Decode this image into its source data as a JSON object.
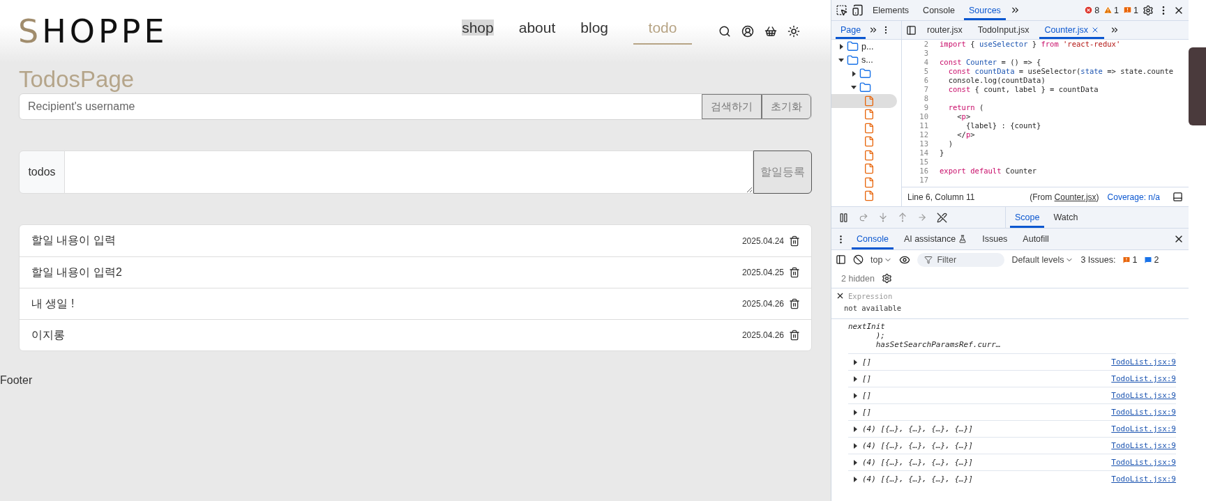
{
  "app": {
    "logo": {
      "first": "S",
      "rest": "HOPPE"
    },
    "nav": [
      {
        "label": "shop",
        "selected": false,
        "hovered": true
      },
      {
        "label": "about",
        "selected": false,
        "hovered": false
      },
      {
        "label": "blog",
        "selected": false,
        "hovered": false
      },
      {
        "label": "todo",
        "selected": true,
        "hovered": false
      }
    ],
    "page_title": "TodosPage",
    "search": {
      "placeholder": "Recipient's username",
      "buttons": [
        "검색하기",
        "초기화"
      ]
    },
    "todo_form": {
      "label": "todos",
      "button": "할일등록"
    },
    "todos": [
      {
        "text": "할일 내용이 입력",
        "date": "2025.04.24"
      },
      {
        "text": "할일 내용이 입력2",
        "date": "2025.04.25"
      },
      {
        "text": "내 생일 !",
        "date": "2025.04.26"
      },
      {
        "text": "이지롱",
        "date": "2025.04.26"
      }
    ],
    "footer": "Footer"
  },
  "devtools": {
    "tabs": [
      {
        "label": "Elements",
        "selected": false
      },
      {
        "label": "Console",
        "selected": false
      },
      {
        "label": "Sources",
        "selected": true
      }
    ],
    "counts": {
      "errors": "8",
      "warnings": "1",
      "issues": "1"
    },
    "navigator_tabs": [
      {
        "label": "Page",
        "selected": true
      }
    ],
    "file_tabs": [
      {
        "label": "router.jsx",
        "selected": false,
        "closable": false
      },
      {
        "label": "TodoInput.jsx",
        "selected": false,
        "closable": false
      },
      {
        "label": "Counter.jsx",
        "selected": true,
        "closable": true
      }
    ],
    "tree": [
      {
        "label": "p...",
        "expanded": false
      },
      {
        "label": "s...",
        "expanded": true,
        "children": [
          {
            "expanded": false
          },
          {
            "expanded": true,
            "children": [
              {
                "kind": "file",
                "selected": true
              },
              {
                "kind": "file",
                "selected": false
              },
              {
                "kind": "file",
                "selected": false
              },
              {
                "kind": "file",
                "selected": false
              },
              {
                "kind": "file",
                "selected": false
              },
              {
                "kind": "file",
                "selected": false
              },
              {
                "kind": "file",
                "selected": false
              },
              {
                "kind": "file",
                "selected": false
              }
            ]
          }
        ]
      }
    ],
    "code": [
      {
        "number": "2",
        "tokens": [
          {
            "kind": "keyword",
            "text": "import "
          },
          {
            "kind": "plain",
            "text": "{ "
          },
          {
            "kind": "name",
            "text": "useSelector"
          },
          {
            "kind": "plain",
            "text": " } "
          },
          {
            "kind": "keyword",
            "text": "from "
          },
          {
            "kind": "string",
            "text": "'react-redux'"
          }
        ]
      },
      {
        "number": "3"
      },
      {
        "number": "4",
        "tokens": [
          {
            "kind": "keyword",
            "text": "const "
          },
          {
            "kind": "name",
            "text": "Counter"
          },
          {
            "kind": "plain",
            "text": " = () => {"
          }
        ]
      },
      {
        "number": "5",
        "tokens": [
          {
            "kind": "keyword",
            "text": "  const "
          },
          {
            "kind": "name",
            "text": "countData"
          },
          {
            "kind": "plain",
            "text": " = useSelector("
          },
          {
            "kind": "name",
            "text": "state"
          },
          {
            "kind": "plain",
            "text": " => state.counte"
          }
        ]
      },
      {
        "number": "6",
        "tokens": [
          {
            "kind": "plain",
            "text": "  console.log(countData)"
          }
        ]
      },
      {
        "number": "7",
        "tokens": [
          {
            "kind": "keyword",
            "text": "  const "
          },
          {
            "kind": "plain",
            "text": "{ count, label } = countData"
          }
        ]
      },
      {
        "number": "8"
      },
      {
        "number": "9",
        "tokens": [
          {
            "kind": "keyword",
            "text": "  return "
          },
          {
            "kind": "plain",
            "text": "("
          }
        ]
      },
      {
        "number": "10",
        "tokens": [
          {
            "kind": "plain",
            "text": "    <"
          },
          {
            "kind": "keyword",
            "text": "p"
          },
          {
            "kind": "plain",
            "text": ">"
          }
        ]
      },
      {
        "number": "11",
        "tokens": [
          {
            "kind": "plain",
            "text": "      {label} : {count}"
          }
        ]
      },
      {
        "number": "12",
        "tokens": [
          {
            "kind": "plain",
            "text": "    </"
          },
          {
            "kind": "keyword",
            "text": "p"
          },
          {
            "kind": "plain",
            "text": ">"
          }
        ]
      },
      {
        "number": "13",
        "tokens": [
          {
            "kind": "plain",
            "text": "  )"
          }
        ]
      },
      {
        "number": "14",
        "tokens": [
          {
            "kind": "plain",
            "text": "}"
          }
        ]
      },
      {
        "number": "15"
      },
      {
        "number": "16",
        "tokens": [
          {
            "kind": "keyword",
            "text": "export default "
          },
          {
            "kind": "plain",
            "text": "Counter"
          }
        ]
      },
      {
        "number": "17"
      }
    ],
    "status": {
      "position": "Line 6, Column 11",
      "source_before": "(From ",
      "source_link": "Counter.jsx",
      "source_after": ")",
      "coverage": "Coverage: n/a"
    },
    "debugger_tabs": [
      {
        "label": "Scope",
        "selected": true
      },
      {
        "label": "Watch",
        "selected": false
      }
    ],
    "drawer_tabs": [
      {
        "label": "Console",
        "selected": true
      },
      {
        "label": "AI assistance",
        "selected": false
      },
      {
        "label": "Issues",
        "selected": false
      },
      {
        "label": "Autofill",
        "selected": false
      }
    ],
    "console_toolbar": {
      "context": "top",
      "filter_placeholder": "Filter",
      "levels": "Default levels",
      "issues_label": "3 Issues:",
      "issue_warnings": "1",
      "issue_infos": "2",
      "hidden": "2 hidden"
    },
    "expression": {
      "placeholder": "Expression",
      "value": "not available"
    },
    "log_fragment": [
      "nextInit",
      "      );",
      "      hasSetSearchParamsRef.curr…"
    ],
    "logs": [
      {
        "text": "[]",
        "source": "TodoList.jsx:9"
      },
      {
        "text": "[]",
        "source": "TodoList.jsx:9"
      },
      {
        "text": "[]",
        "source": "TodoList.jsx:9"
      },
      {
        "text": "[]",
        "source": "TodoList.jsx:9"
      },
      {
        "text": "(4) [{…}, {…}, {…}, {…}]",
        "source": "TodoList.jsx:9"
      },
      {
        "text": "(4) [{…}, {…}, {…}, {…}]",
        "source": "TodoList.jsx:9"
      },
      {
        "text": "(4) [{…}, {…}, {…}, {…}]",
        "source": "TodoList.jsx:9"
      },
      {
        "text": "(4) [{…}, {…}, {…}, {…}]",
        "source": "TodoList.jsx:9"
      }
    ]
  }
}
